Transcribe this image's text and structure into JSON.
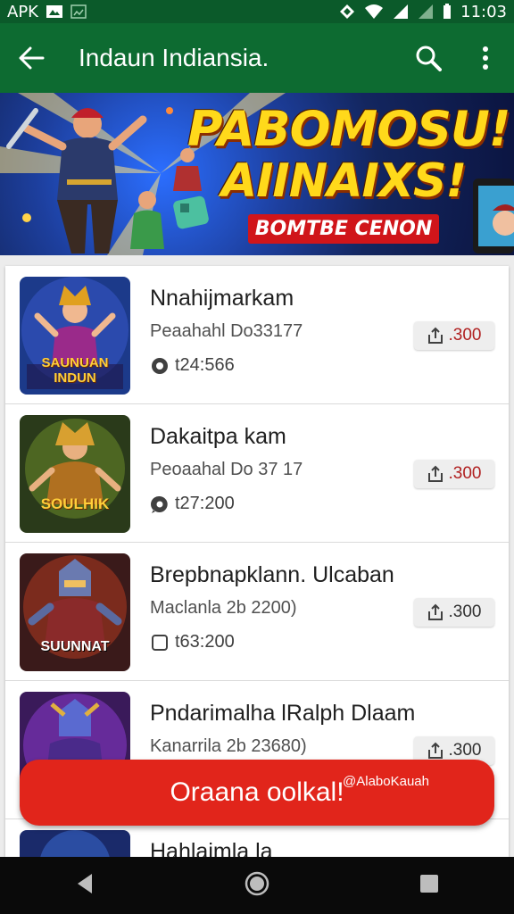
{
  "status_bar": {
    "left_text": "APK",
    "time": "11:03"
  },
  "app_bar": {
    "title": "Indaun Indiansia."
  },
  "banner": {
    "title_line1": "PABOMOSU!",
    "title_line2": "AIINAIXS!",
    "subtitle": "BOMTBE CENON"
  },
  "items": [
    {
      "name": "Nnahijmarkam",
      "sub": "Peaahahl Do33177",
      "count": "t24:566",
      "button": ".300",
      "thumb_label": "SAUNUAN INDUN"
    },
    {
      "name": "Dakaitpa kam",
      "sub": "Peoaahal Do 37 17",
      "count": "t27:200",
      "button": ".300",
      "thumb_label": "SOULHIK"
    },
    {
      "name": "Brepbnapklann. Ulcaban",
      "sub": "Maclanla 2b 2200)",
      "count": "t63:200",
      "button": ".300",
      "thumb_label": "SUUNNAT"
    },
    {
      "name": "Pndarimalha lRalph Dlaam",
      "sub": "Kanarrila 2b 23680)",
      "count": "",
      "button": ".300",
      "thumb_label": ""
    },
    {
      "name": "Hahlaimla la",
      "sub": "",
      "count": "",
      "button": "",
      "thumb_label": ""
    }
  ],
  "fab": {
    "label": "Oraana oolkal!",
    "small_label": "@AlaboKauah"
  },
  "colors": {
    "status_bar": "#0b5a2a",
    "app_bar": "#0d6b31",
    "fab": "#e1251b",
    "navbar": "#0a0a0a"
  },
  "icons": [
    "back-arrow-icon",
    "search-icon",
    "more-vert-icon",
    "share-icon",
    "chat-icon",
    "nav-back-icon",
    "nav-home-icon",
    "nav-recents-icon"
  ]
}
